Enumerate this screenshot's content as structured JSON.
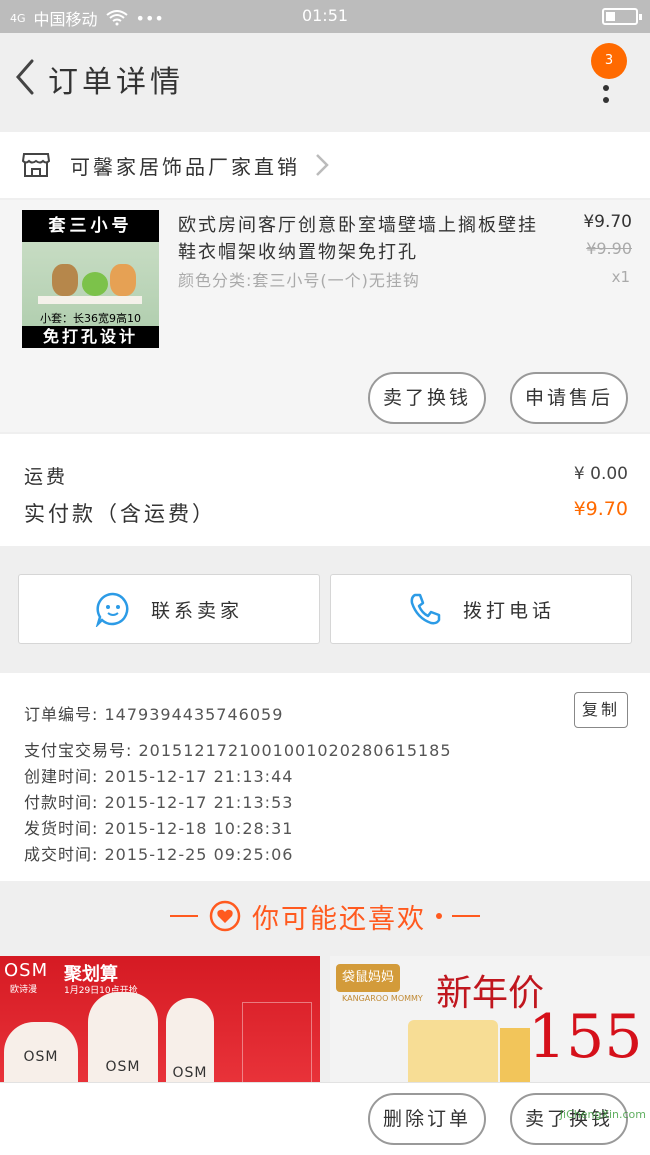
{
  "status_bar": {
    "carrier": "中国移动",
    "signal_label": "4G",
    "time": "01:51",
    "dots": "•••"
  },
  "header": {
    "title": "订单详情",
    "badge": "3"
  },
  "shop": {
    "name": "可馨家居饰品厂家直销"
  },
  "product": {
    "image_top_text": "套三小号",
    "image_size_text": "小套：长36宽9高10",
    "image_bottom_text": "免打孔设计",
    "title": "欧式房间客厅创意卧室墙壁墙上搁板壁挂鞋衣帽架收纳置物架免打孔",
    "spec": "颜色分类:套三小号(一个)无挂钩",
    "price": "¥9.70",
    "original_price": "¥9.90",
    "quantity": "x1",
    "actions": {
      "buy_again": "卖了换钱",
      "after_sale": "申请售后"
    }
  },
  "totals": {
    "shipping_label": "运费",
    "shipping_value": "¥ 0.00",
    "paid_label": "实付款（含运费）",
    "paid_value": "¥9.70"
  },
  "contact": {
    "seller_label": "联系卖家",
    "call_label": "拨打电话"
  },
  "order_info": {
    "copy_label": "复制",
    "lines": [
      {
        "label": "订单编号:",
        "value": "1479394435746059"
      },
      {
        "label": "支付宝交易号:",
        "value": "2015121721001001020280615185"
      },
      {
        "label": "创建时间:",
        "value": "2015-12-17  21:13:44"
      },
      {
        "label": "付款时间:",
        "value": "2015-12-17  21:13:53"
      },
      {
        "label": "发货时间:",
        "value": "2015-12-18  10:28:31"
      },
      {
        "label": "成交时间:",
        "value": "2015-12-25  09:25:06"
      }
    ]
  },
  "recommend": {
    "title": "你可能还喜欢",
    "left_card": {
      "brand": "OSM",
      "brand_sub": "欧诗漫",
      "campaign": "聚划算",
      "campaign_date": "1月29日10点开抢",
      "bottle_label": "OSM"
    },
    "right_card": {
      "brand": "袋鼠妈妈",
      "brand_sub": "KANGAROO MOMMY",
      "headline": "新年价",
      "price": "155"
    }
  },
  "footer": {
    "delete_label": "删除订单",
    "sell_label": "卖了换钱"
  },
  "watermark": "JiChengXin.com"
}
